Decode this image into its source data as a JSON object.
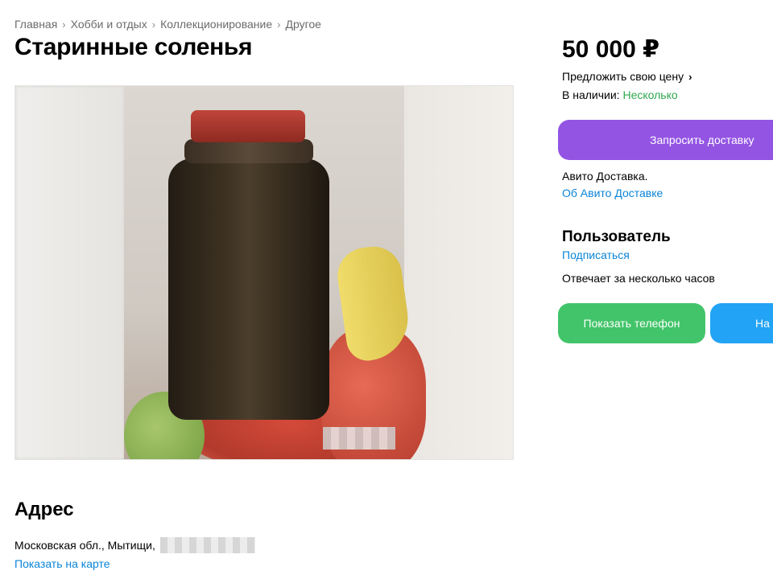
{
  "breadcrumb": {
    "items": [
      "Главная",
      "Хобби и отдых",
      "Коллекционирование",
      "Другое"
    ]
  },
  "listing": {
    "title": "Старинные соленья",
    "price": "50 000 ₽",
    "offer_price_label": "Предложить свою цену",
    "availability_label": "В наличии:",
    "availability_value": "Несколько"
  },
  "delivery": {
    "button_label": "Запросить доставку",
    "service_label": "Авито Доставка.",
    "about_link": "Об Авито Доставке"
  },
  "seller": {
    "name": "Пользователь",
    "subscribe_label": "Подписаться",
    "reply_time": "Отвечает за несколько часов",
    "show_phone_label": "Показать телефон",
    "write_label_visible": "На"
  },
  "address": {
    "heading": "Адрес",
    "text": "Московская обл., Мытищи,",
    "map_link": "Показать на карте"
  },
  "colors": {
    "delivery_button": "#9354e3",
    "phone_button": "#42c46a",
    "write_button": "#22a3f5",
    "link": "#0a84d6",
    "in_stock": "#2fa84f"
  },
  "icons": {
    "offer_chevron": "chevron-right-icon",
    "breadcrumb_separator": "chevron-right-icon"
  }
}
